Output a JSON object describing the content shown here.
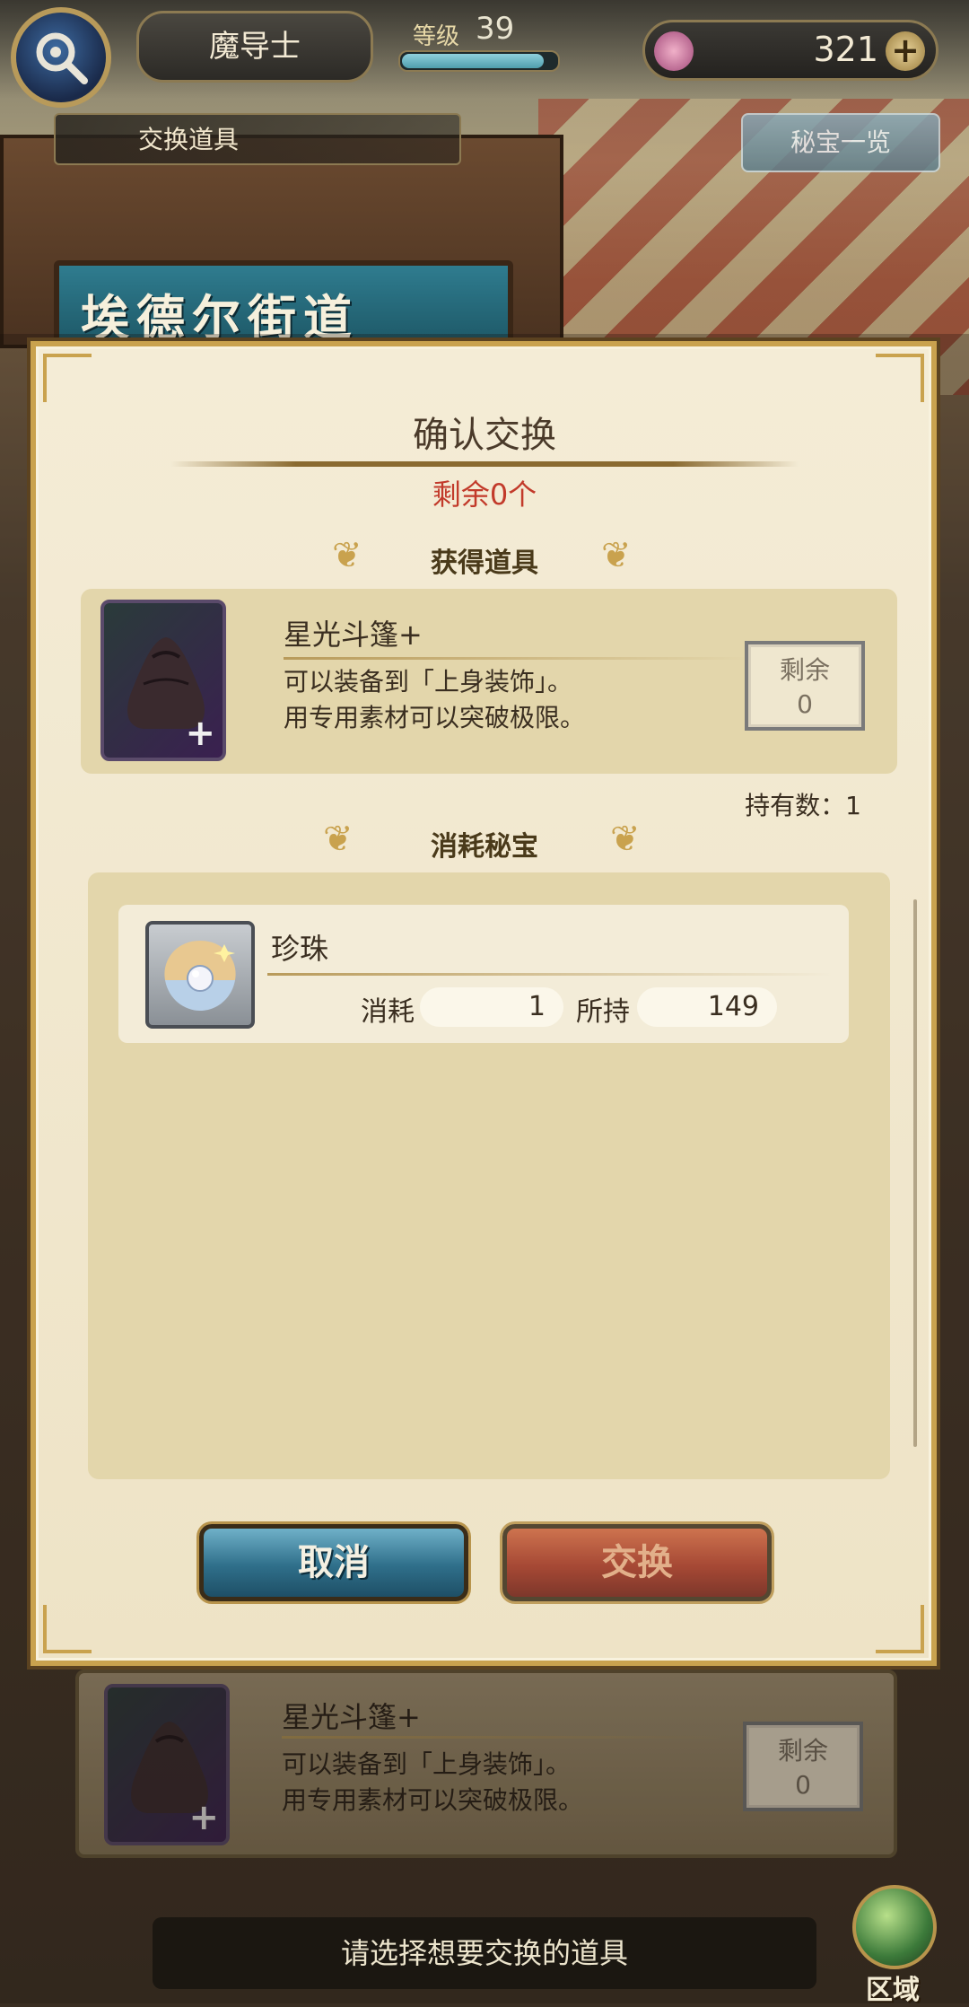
{
  "scene": {
    "street_sign": "埃德尔街道"
  },
  "header": {
    "class_name": "魔导士",
    "level_label": "等级",
    "level": "39",
    "level_progress": 0.92,
    "currency_value": "321",
    "plus_glyph": "+",
    "tab_label": "交换道具",
    "treasure_list_label": "秘宝一览"
  },
  "dialog": {
    "title": "确认交换",
    "remaining": "剩余0个",
    "obtain_section": "获得道具",
    "obtain_item": {
      "name": "星光斗篷+",
      "desc_line1": "可以装备到「上身装饰」。",
      "desc_line2": "用专用素材可以突破极限。",
      "remain_label": "剩余",
      "remain_value": "0",
      "plus_glyph": "+"
    },
    "owned_count": "持有数：1",
    "consume_section": "消耗秘宝",
    "consume_item": {
      "name": "珍珠",
      "consume_label": "消耗",
      "consume_value": "1",
      "held_label": "所持",
      "held_value": "149"
    },
    "cancel_label": "取消",
    "exchange_label": "交换"
  },
  "bg_item": {
    "name": "星光斗篷+",
    "desc_line1": "可以装备到「上身装饰」。",
    "desc_line2": "用专用素材可以突破极限。",
    "remain_label": "剩余",
    "remain_value": "0",
    "plus_glyph": "+"
  },
  "footer": {
    "hint": "请选择想要交换的道具",
    "region_label": "区域"
  },
  "colors": {
    "accent_gold": "#c9a24e",
    "remaining_red": "#c23a2a",
    "cancel_blue": "#2f6f8a",
    "exchange_red": "#9a2e1c"
  },
  "icons": [
    "search-icon",
    "gem-icon",
    "plus-icon",
    "cloak-icon",
    "pearl-icon",
    "globe-icon",
    "flourish-icon"
  ]
}
